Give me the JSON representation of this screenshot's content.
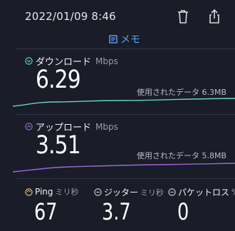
{
  "header": {
    "datetime": "2022/01/09 8:46",
    "memo_label": "メモ",
    "icons": [
      "trash-icon",
      "share-icon",
      "memo-icon"
    ]
  },
  "download": {
    "label": "ダウンロード",
    "unit": "Mbps",
    "value": "6.29",
    "data_used_label": "使用されたデータ",
    "data_used_value": "6.3MB",
    "color": "#5fd6c8"
  },
  "upload": {
    "label": "アップロード",
    "unit": "Mbps",
    "value": "3.51",
    "data_used_label": "使用されたデータ",
    "data_used_value": "5.8MB",
    "color": "#9b66e0"
  },
  "ping": {
    "label": "Ping",
    "unit": "ミリ秒",
    "value": "67",
    "color": "#e9c46a"
  },
  "jitter": {
    "label": "ジッター",
    "unit": "ミリ秒",
    "value": "3.7"
  },
  "packet_loss": {
    "label": "パケットロス",
    "unit": "%",
    "value": "0"
  },
  "colors": {
    "background": "#1a1c27",
    "accent": "#5da3ff"
  }
}
